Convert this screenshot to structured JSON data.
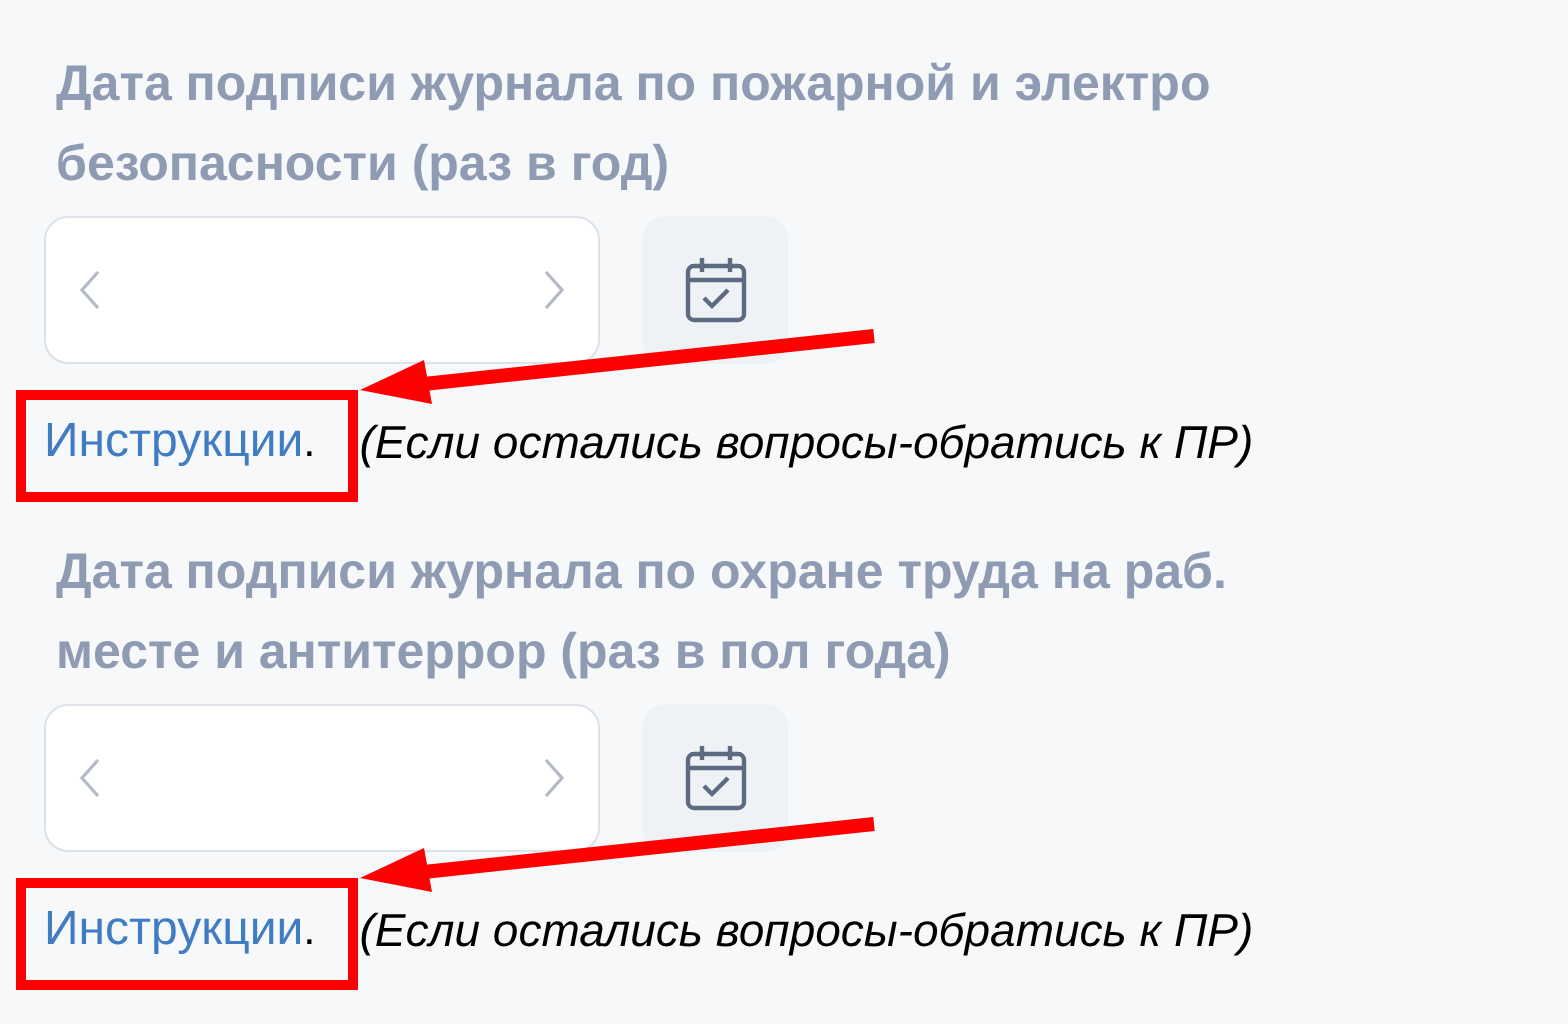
{
  "sections": [
    {
      "title": "Дата подписи журнала по пожарной и электро безопасности (раз в год)",
      "link": "Инструкции",
      "after_link": ".",
      "note": "(Если остались вопросы-обратись к ПР)",
      "highlighted": true
    },
    {
      "title": "Дата подписи журнала по охране труда на раб. месте и антитеррор (раз в пол года)",
      "link": "Инструкции",
      "after_link": ".",
      "note": "(Если остались вопросы-обратись к ПР)",
      "highlighted": true
    }
  ]
}
